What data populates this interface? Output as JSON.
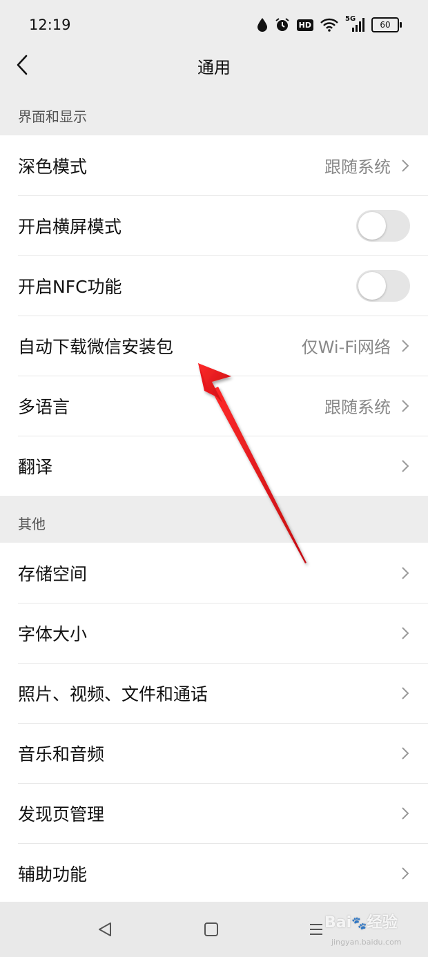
{
  "status_bar": {
    "time": "12:19",
    "network": "5G",
    "battery": "60",
    "hd_badge": "HD",
    "icons": [
      "drop-icon",
      "alarm-icon",
      "hd-icon",
      "wifi-icon",
      "signal-icon",
      "battery-icon"
    ]
  },
  "header": {
    "title": "通用"
  },
  "sections": [
    {
      "title": "界面和显示",
      "items": [
        {
          "label": "深色模式",
          "value": "跟随系统",
          "control": "chevron"
        },
        {
          "label": "开启横屏模式",
          "value": "",
          "control": "toggle",
          "on": false
        },
        {
          "label": "开启NFC功能",
          "value": "",
          "control": "toggle",
          "on": false
        },
        {
          "label": "自动下载微信安装包",
          "value": "仅Wi-Fi网络",
          "control": "chevron"
        },
        {
          "label": "多语言",
          "value": "跟随系统",
          "control": "chevron"
        },
        {
          "label": "翻译",
          "value": "",
          "control": "chevron"
        }
      ]
    },
    {
      "title": "其他",
      "items": [
        {
          "label": "存储空间",
          "value": "",
          "control": "chevron"
        },
        {
          "label": "字体大小",
          "value": "",
          "control": "chevron"
        },
        {
          "label": "照片、视频、文件和通话",
          "value": "",
          "control": "chevron"
        },
        {
          "label": "音乐和音频",
          "value": "",
          "control": "chevron"
        },
        {
          "label": "发现页管理",
          "value": "",
          "control": "chevron"
        },
        {
          "label": "辅助功能",
          "value": "",
          "control": "chevron"
        }
      ]
    }
  ],
  "watermark": {
    "brand": "Bai",
    "suffix": "经验",
    "sub": "jingyan.baidu.com"
  },
  "colors": {
    "background": "#ededed",
    "card": "#ffffff",
    "annotation_arrow": "#e8141c",
    "toggle_off": "#e5e5e5"
  }
}
